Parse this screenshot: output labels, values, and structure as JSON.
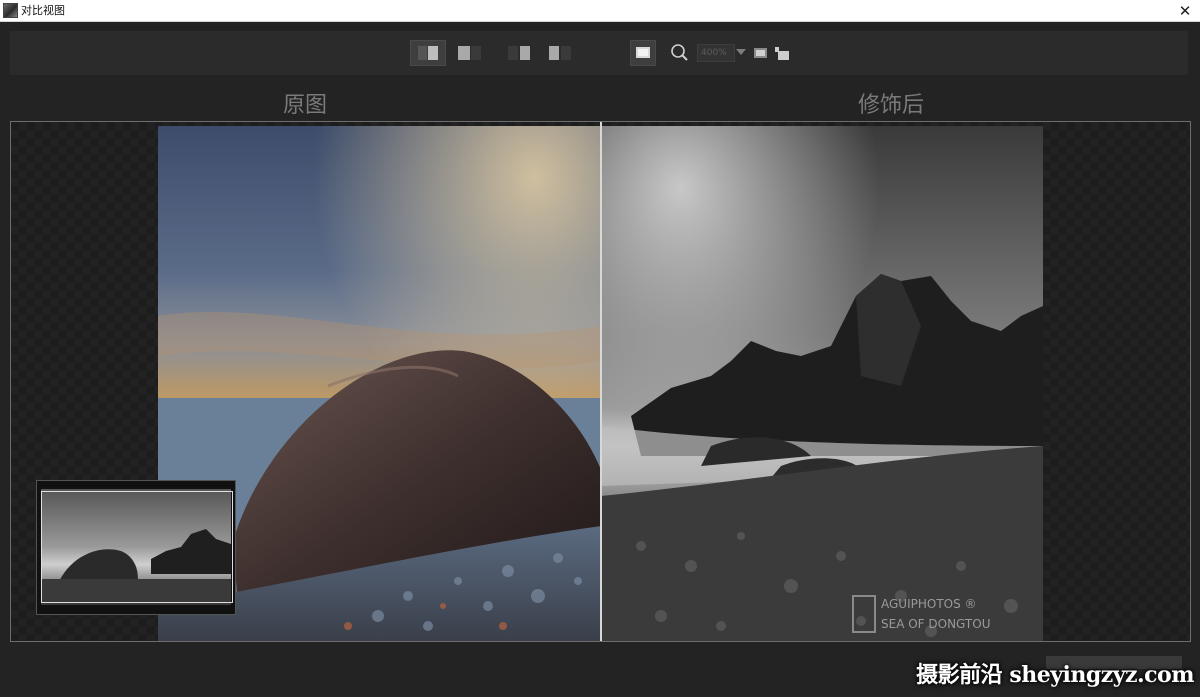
{
  "window": {
    "title": "对比视图",
    "close_glyph": "✕"
  },
  "toolbar": {
    "zoom_level": "400%",
    "buttons": [
      {
        "name": "split-view-left-right",
        "icon": "split-lr-icon",
        "active": true
      },
      {
        "name": "split-view-left-only",
        "icon": "split-left-icon",
        "active": false
      },
      {
        "name": "side-by-side-right",
        "icon": "split-right-icon",
        "active": false
      },
      {
        "name": "side-by-side-both",
        "icon": "split-both-icon",
        "active": false
      },
      {
        "name": "single-view",
        "icon": "single-view-icon",
        "active": true
      },
      {
        "name": "zoom",
        "icon": "magnifier-icon",
        "active": false
      },
      {
        "name": "fit-window",
        "icon": "fit-icon",
        "active": false
      },
      {
        "name": "pan",
        "icon": "hand-icon",
        "active": false
      }
    ]
  },
  "panes": {
    "original_label": "原图",
    "modified_label": "修饰后"
  },
  "photo_watermark": {
    "line1": "AGUIPHOTOS ®",
    "line2": "SEA OF DONGTOU"
  },
  "site_watermark": "摄影前沿 sheyingzyz.com",
  "colors": {
    "background": "#232323",
    "toolbar": "#2b2b2b",
    "label": "#7a7a7a",
    "divider": "#d8d8d8",
    "sunset": "#f4b83a"
  }
}
